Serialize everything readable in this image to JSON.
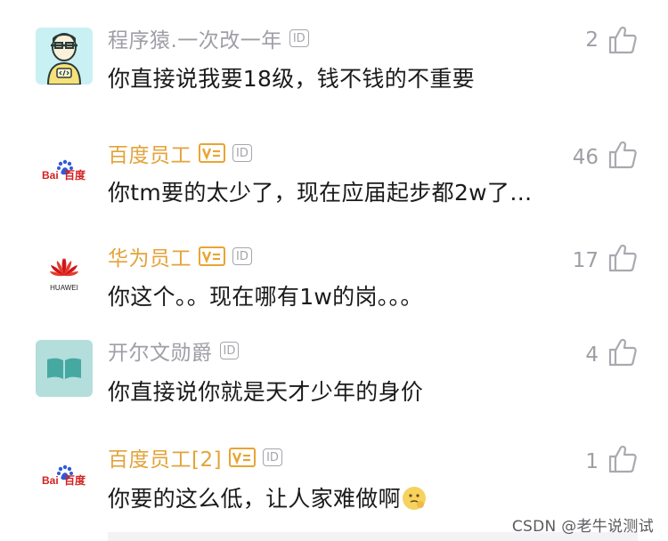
{
  "comments": [
    {
      "author": "程序猿.一次改一年",
      "author_badge": "ID",
      "text": "你直接说我要18级，钱不钱的不重要",
      "likes": "2",
      "avatar": "coder-avatar"
    },
    {
      "author": "百度员工",
      "author_badge": "ID",
      "text": "你tm要的太少了，现在应届起步都2w了…",
      "likes": "46",
      "avatar": "baidu-logo",
      "avatar_text": "Bai百度"
    },
    {
      "author": "华为员工",
      "author_badge": "ID",
      "text": "你这个。。现在哪有1w的岗。。。",
      "likes": "17",
      "avatar": "huawei-logo",
      "avatar_text": "HUAWEI"
    },
    {
      "author": "开尔文勋爵",
      "author_badge": "ID",
      "text": "你直接说你就是天才少年的身价",
      "likes": "4",
      "avatar": "book-avatar"
    },
    {
      "author": "百度员工[2]",
      "author_badge": "ID",
      "text": "你要的这么低，让人家难做啊",
      "likes": "1",
      "avatar": "baidu-logo",
      "avatar_text": "Bai百度"
    }
  ],
  "watermark": "CSDN @老牛说测试",
  "colors": {
    "name_gray": "#9e9ea6",
    "name_gold": "#e3a33a",
    "text": "#1a1a1a"
  }
}
